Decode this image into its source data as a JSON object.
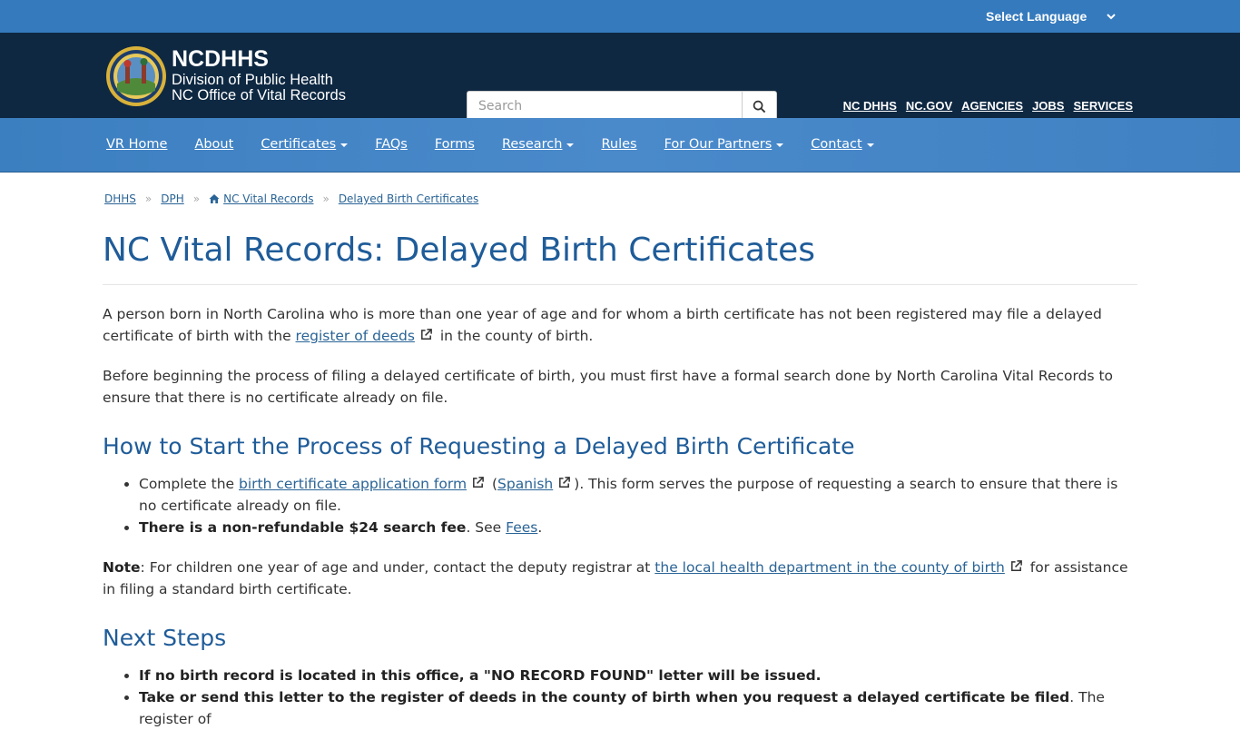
{
  "language": {
    "label": "Select Language"
  },
  "brand": {
    "name": "NCDHHS",
    "line2": "Division of Public Health",
    "line3": "NC Office of Vital Records"
  },
  "search": {
    "placeholder": "Search"
  },
  "util_links": [
    "NC DHHS",
    "NC.GOV",
    "AGENCIES",
    "JOBS",
    "SERVICES"
  ],
  "nav": {
    "items": [
      {
        "label": "VR Home",
        "dropdown": false
      },
      {
        "label": "About",
        "dropdown": false
      },
      {
        "label": "Certificates",
        "dropdown": true
      },
      {
        "label": "FAQs",
        "dropdown": false
      },
      {
        "label": "Forms",
        "dropdown": false
      },
      {
        "label": "Research",
        "dropdown": true
      },
      {
        "label": "Rules",
        "dropdown": false
      },
      {
        "label": "For Our Partners",
        "dropdown": true
      },
      {
        "label": "Contact",
        "dropdown": true
      }
    ]
  },
  "breadcrumb": [
    "DHHS",
    "DPH",
    "NC Vital Records",
    "Delayed Birth Certificates"
  ],
  "page": {
    "title": "NC Vital Records: Delayed Birth Certificates",
    "p1_a": "A person born in North Carolina who is more than one year of age and for whom a birth certificate has not been registered may file a delayed certificate of birth with the ",
    "p1_link": "register of deeds",
    "p1_b": " in the county of birth.",
    "p2": "Before beginning the process of filing a delayed certificate of birth, you must first have a formal search done by North Carolina Vital Records to ensure that there is no certificate already on file.",
    "h2_1": "How to Start the Process of Requesting a Delayed Birth Certificate",
    "li1_a": "Complete the ",
    "li1_link": "birth certificate application form",
    "li1_b": " (",
    "li1_link2": "Spanish",
    "li1_c": "). This form serves the purpose of requesting a search to ensure that there is no certificate already on file.",
    "li2_bold": "There is a non-refundable $24 search fee",
    "li2_a": ". See ",
    "li2_link": "Fees",
    "li2_b": ".",
    "note_bold": "Note",
    "note_a": ": For children one year of age and under, contact the deputy registrar at ",
    "note_link": "the local health department in the county of birth",
    "note_b": " for assistance in filing a standard birth certificate.",
    "h2_2": "Next Steps",
    "li3_bold": "If no birth record is located in this office, a \"NO RECORD FOUND\" letter will be issued.",
    "li4_bold": "Take or send this letter to the register of deeds in the county of birth when you request a delayed certificate be filed",
    "li4_a": ". The register of"
  },
  "colors": {
    "lang_bar": "#357abd",
    "header": "#0e2842",
    "nav": "#4a8acb",
    "heading": "#1f5c99",
    "link": "#2a6496"
  }
}
